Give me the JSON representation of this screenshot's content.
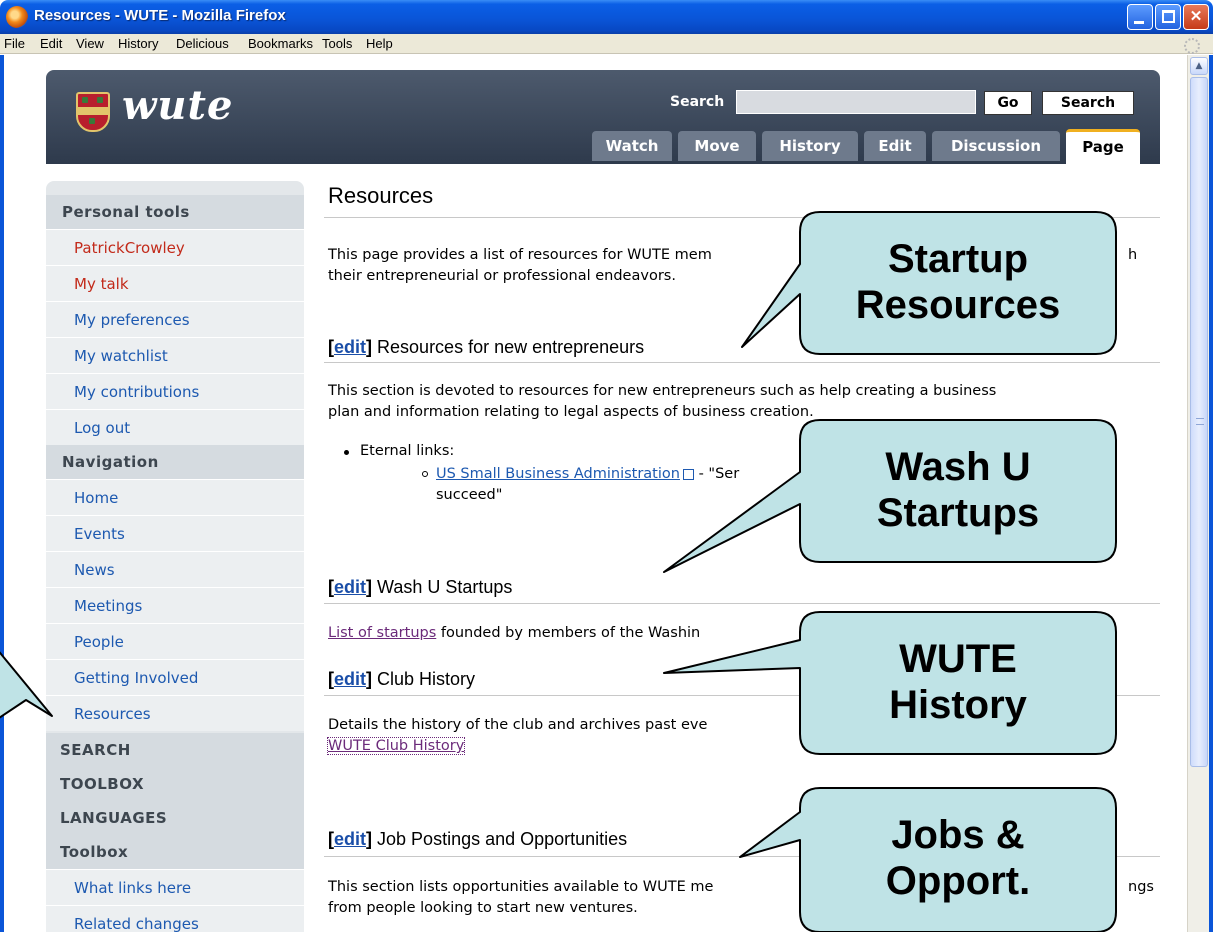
{
  "window": {
    "title": "Resources - WUTE - Mozilla Firefox",
    "colors": {
      "titlebar": "#0a55d8",
      "close": "#c63a18"
    }
  },
  "menubar": {
    "items": [
      "File",
      "Edit",
      "View",
      "History",
      "Delicious",
      "Bookmarks",
      "Tools",
      "Help"
    ]
  },
  "header": {
    "logo_text": "wute",
    "search_label": "Search",
    "search_value": "",
    "go_label": "Go",
    "search_button_label": "Search",
    "tabs": [
      "Watch",
      "Move",
      "History",
      "Edit",
      "Discussion",
      "Page"
    ],
    "active_tab": "Page",
    "colors": {
      "banner": "#3a4657",
      "active_tab_accent": "#f0b020"
    }
  },
  "sidebar": {
    "personal_tools_heading": "Personal tools",
    "personal_items": [
      "PatrickCrowley",
      "My talk",
      "My preferences",
      "My watchlist",
      "My contributions",
      "Log out"
    ],
    "navigation_heading": "Navigation",
    "navigation_items": [
      "Home",
      "Events",
      "News",
      "Meetings",
      "People",
      "Getting Involved",
      "Resources"
    ],
    "collapsed_headings": [
      "SEARCH",
      "TOOLBOX",
      "LANGUAGES"
    ],
    "toolbox_heading": "Toolbox",
    "toolbox_items": [
      "What links here",
      "Related changes"
    ]
  },
  "main": {
    "title": "Resources",
    "intro_line1": "This page provides a list of resources for WUTE mem",
    "intro_line1_end": "h",
    "intro_line2": "their entrepreneurial or professional endeavors.",
    "edit_label": "edit",
    "sections": [
      {
        "heading": "Resources for new entrepreneurs",
        "text_line1": "This section is devoted to resources for new entrepreneurs such as help creating a business",
        "text_line2": "plan and information relating to legal aspects of business creation.",
        "bullet": "Eternal links:",
        "sub_link": "US Small Business Administration",
        "sub_after": " - \"Ser",
        "sub_line2": "succeed\""
      },
      {
        "heading": "Wash U Startups",
        "link": "List of startups",
        "text": " founded by members of the Washin"
      },
      {
        "heading": "Club History",
        "text": "Details the history of the club and archives past eve",
        "link": "WUTE Club History"
      },
      {
        "heading": "Job Postings and Opportunities",
        "text_line1": "This section lists opportunities available to WUTE me",
        "text_line1_end": "ngs",
        "text_line2": "from people looking to start new ventures."
      }
    ]
  },
  "callouts": [
    {
      "line1": "Startup",
      "line2": "Resources"
    },
    {
      "line1": "Wash U",
      "line2": "Startups"
    },
    {
      "line1": "WUTE",
      "line2": "History"
    },
    {
      "line1": "Jobs &",
      "line2": "Opport."
    }
  ],
  "colors": {
    "callout_fill": "#bfe3e6",
    "link": "#1d59b0",
    "sidebar": "#e3e7ea"
  }
}
